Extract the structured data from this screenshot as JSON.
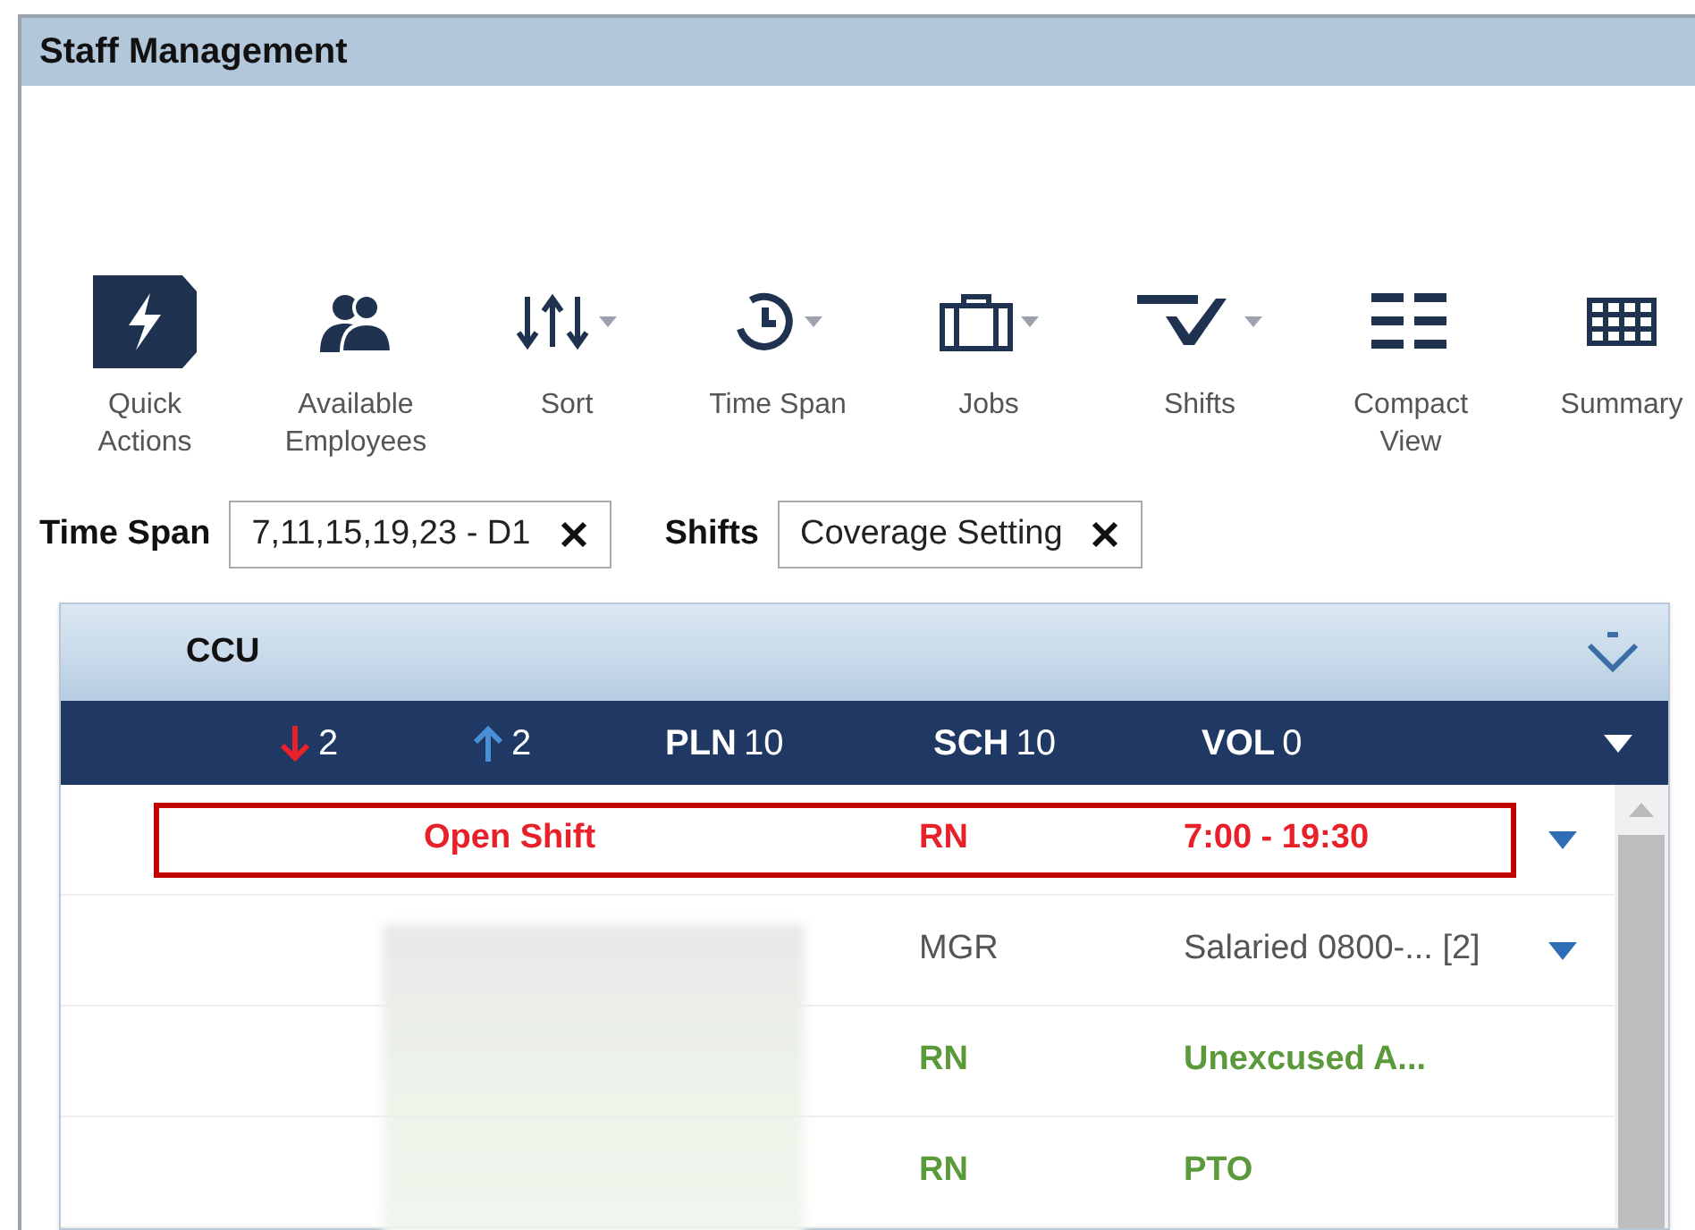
{
  "window": {
    "title": "Staff Management"
  },
  "toolbar": [
    {
      "kind": "bolt",
      "label": "Quick Actions",
      "dropdown": false
    },
    {
      "kind": "people",
      "label": "Available Employees",
      "dropdown": false
    },
    {
      "kind": "sort",
      "label": "Sort",
      "dropdown": true
    },
    {
      "kind": "clock",
      "label": "Time Span",
      "dropdown": true
    },
    {
      "kind": "briefcase",
      "label": "Jobs",
      "dropdown": true
    },
    {
      "kind": "check",
      "label": "Shifts",
      "dropdown": true
    },
    {
      "kind": "list",
      "label": "Compact View",
      "dropdown": false
    },
    {
      "kind": "grid",
      "label": "Summary",
      "dropdown": false
    }
  ],
  "filters": [
    {
      "label": "Time Span",
      "value": "7,11,15,19,23 - D1"
    },
    {
      "label": "Shifts",
      "value": "Coverage Setting"
    }
  ],
  "unit": {
    "name": "CCU",
    "stats": [
      {
        "kind": "down",
        "value": "2"
      },
      {
        "kind": "up",
        "value": "2"
      },
      {
        "kind": "label",
        "label": "PLN",
        "value": "10"
      },
      {
        "kind": "label",
        "label": "SCH",
        "value": "10"
      },
      {
        "kind": "label",
        "label": "VOL",
        "value": "0"
      }
    ]
  },
  "rows": [
    {
      "kind": "open",
      "name": "Open Shift",
      "job": "RN",
      "shift": "7:00 - 19:30",
      "has_menu": true,
      "selected": true
    },
    {
      "kind": "normal",
      "job": "MGR",
      "shift": "Salaried 0800-... [2]",
      "has_menu": true,
      "selected": false
    },
    {
      "kind": "absent",
      "job": "RN",
      "shift": "Unexcused A...",
      "has_menu": false,
      "selected": false
    },
    {
      "kind": "absent",
      "job": "RN",
      "shift": "PTO",
      "has_menu": false,
      "selected": false
    }
  ]
}
